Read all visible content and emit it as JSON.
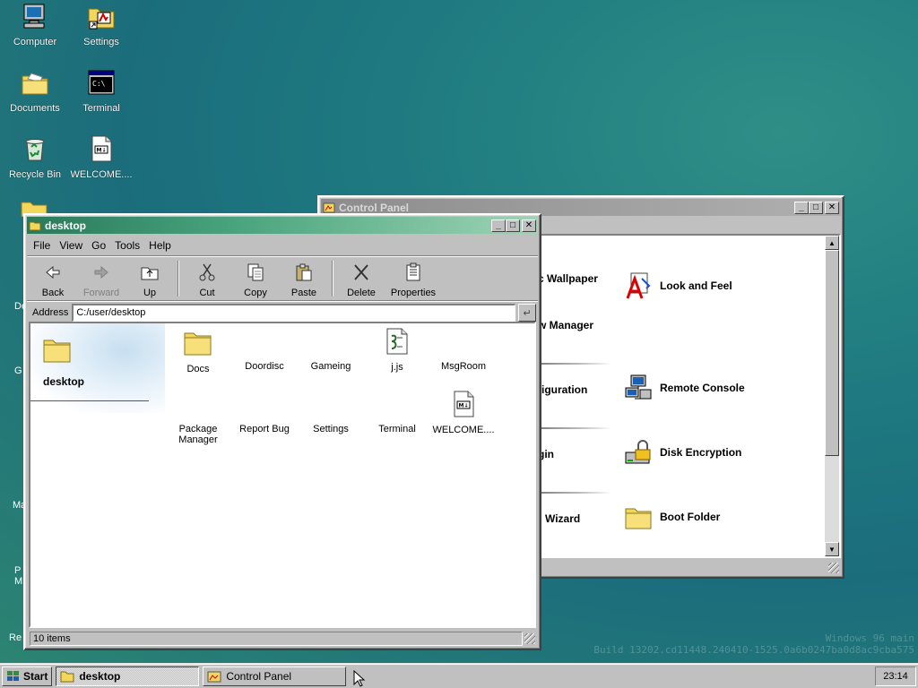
{
  "desktop": {
    "icons": [
      {
        "label": "Computer",
        "icon": "computer-icon"
      },
      {
        "label": "Settings",
        "icon": "settings-icon"
      },
      {
        "label": "Documents",
        "icon": "folder-icon"
      },
      {
        "label": "Terminal",
        "icon": "terminal-icon"
      },
      {
        "label": "Recycle Bin",
        "icon": "recycle-bin-icon"
      },
      {
        "label": "WELCOME....",
        "icon": "markdown-file-icon"
      }
    ],
    "partial_labels": [
      "De",
      "G",
      "Ma",
      "P",
      "M",
      "Re"
    ],
    "watermark": {
      "line1": "Windows 96 main",
      "line2": "Build 13202.cd11448.240410-1525.0a6b0247ba0d8ac9cba575"
    }
  },
  "control_panel": {
    "title": "Control Panel",
    "items": [
      {
        "label": "c Wallpaper",
        "icon": "wallpaper-icon"
      },
      {
        "label": "Look and Feel",
        "icon": "look-and-feel-icon"
      },
      {
        "label": "w Manager",
        "icon": ""
      },
      {
        "label": "figuration",
        "icon": ""
      },
      {
        "label": "Remote Console",
        "icon": "remote-console-icon"
      },
      {
        "label": "gin",
        "icon": ""
      },
      {
        "label": "Disk Encryption",
        "icon": "disk-encryption-icon"
      },
      {
        "label": "Wizard",
        "icon": ""
      },
      {
        "label": "Boot Folder",
        "icon": "folder-icon"
      }
    ]
  },
  "explorer": {
    "title": "desktop",
    "menu": [
      "File",
      "View",
      "Go",
      "Tools",
      "Help"
    ],
    "toolbar": [
      {
        "label": "Back",
        "icon": "back-arrow-icon",
        "disabled": false
      },
      {
        "label": "Forward",
        "icon": "forward-arrow-icon",
        "disabled": true
      },
      {
        "label": "Up",
        "icon": "up-folder-icon",
        "disabled": false
      },
      {
        "label": "Cut",
        "icon": "scissors-icon",
        "disabled": false
      },
      {
        "label": "Copy",
        "icon": "copy-icon",
        "disabled": false
      },
      {
        "label": "Paste",
        "icon": "paste-icon",
        "disabled": false
      },
      {
        "label": "Delete",
        "icon": "delete-x-icon",
        "disabled": false
      },
      {
        "label": "Properties",
        "icon": "properties-icon",
        "disabled": false
      }
    ],
    "address_label": "Address",
    "address_value": "C:/user/desktop",
    "sidebar_title": "desktop",
    "files": [
      {
        "label": "Docs",
        "icon": "folder-icon"
      },
      {
        "label": "Doordisc",
        "icon": ""
      },
      {
        "label": "Gameing",
        "icon": ""
      },
      {
        "label": "j.js",
        "icon": "javascript-file-icon"
      },
      {
        "label": "MsgRoom",
        "icon": ""
      },
      {
        "label": "Package Manager",
        "icon": ""
      },
      {
        "label": "Report Bug",
        "icon": ""
      },
      {
        "label": "Settings",
        "icon": ""
      },
      {
        "label": "Terminal",
        "icon": ""
      },
      {
        "label": "WELCOME....",
        "icon": "markdown-file-icon"
      }
    ],
    "status": "10 items"
  },
  "taskbar": {
    "start_label": "Start",
    "tasks": [
      {
        "label": "desktop",
        "active": true
      },
      {
        "label": "Control Panel",
        "active": false
      }
    ],
    "clock": "23:14"
  }
}
